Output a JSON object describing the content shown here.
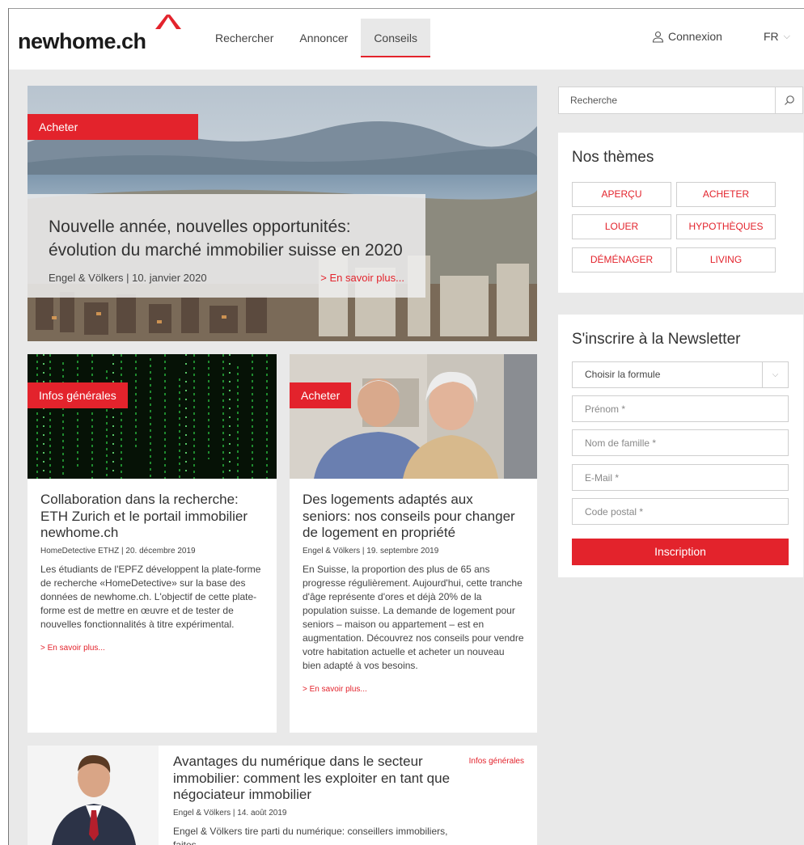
{
  "header": {
    "logo": "newhome.ch",
    "nav": [
      "Rechercher",
      "Annoncer",
      "Conseils"
    ],
    "login": "Connexion",
    "lang": "FR"
  },
  "hero": {
    "tag": "Acheter",
    "title": "Nouvelle année, nouvelles opportunités: évolution du marché immobilier suisse en 2020",
    "meta": "Engel & Völkers | 10. janvier 2020",
    "more": "> En savoir plus..."
  },
  "cards": [
    {
      "tag": "Infos générales",
      "title": "Collaboration dans la recherche: ETH Zurich et le portail immobilier newhome.ch",
      "meta": "HomeDetective ETHZ | 20. décembre 2019",
      "text": "Les étudiants de l'EPFZ développent la plate-forme de recherche «HomeDetective» sur la base des données de newhome.ch. L'objectif de cette plate-forme est de mettre en œuvre et de tester de nouvelles fonctionnalités à titre expérimental.",
      "more": "> En savoir plus..."
    },
    {
      "tag": "Acheter",
      "title": "Des logements adaptés aux seniors: nos conseils pour changer de logement en propriété",
      "meta": "Engel & Völkers | 19. septembre 2019",
      "text": "En Suisse, la proportion des plus de 65 ans progresse régulièrement. Aujourd'hui, cette tranche d'âge représente d'ores et déjà 20% de la population suisse. La demande de logement pour seniors – maison ou appartement – est en augmentation. Découvrez nos conseils pour vendre votre habitation actuelle et acheter un nouveau bien adapté à vos besoins.",
      "more": "> En savoir plus..."
    },
    {
      "tag": "Infos générales",
      "title": "Avantages du numérique dans le secteur immobilier: comment les exploiter en tant que négociateur immobilier",
      "meta": "Engel & Völkers | 14. août 2019",
      "text": "Engel & Völkers tire parti du numérique: conseillers immobiliers, faites"
    }
  ],
  "sidebar": {
    "search_placeholder": "Recherche",
    "themes_title": "Nos thèmes",
    "themes": [
      "APERÇU",
      "ACHETER",
      "LOUER",
      "HYPOTHÈQUES",
      "DÉMÉNAGER",
      "LIVING"
    ],
    "newsletter": {
      "title": "S'inscrire à la Newsletter",
      "select": "Choisir la formule",
      "firstname": "Prénom *",
      "lastname": "Nom de famille *",
      "email": "E-Mail *",
      "zip": "Code postal *",
      "submit": "Inscription"
    }
  },
  "colors": {
    "accent": "#e3232c",
    "background": "#e9e9e9"
  }
}
